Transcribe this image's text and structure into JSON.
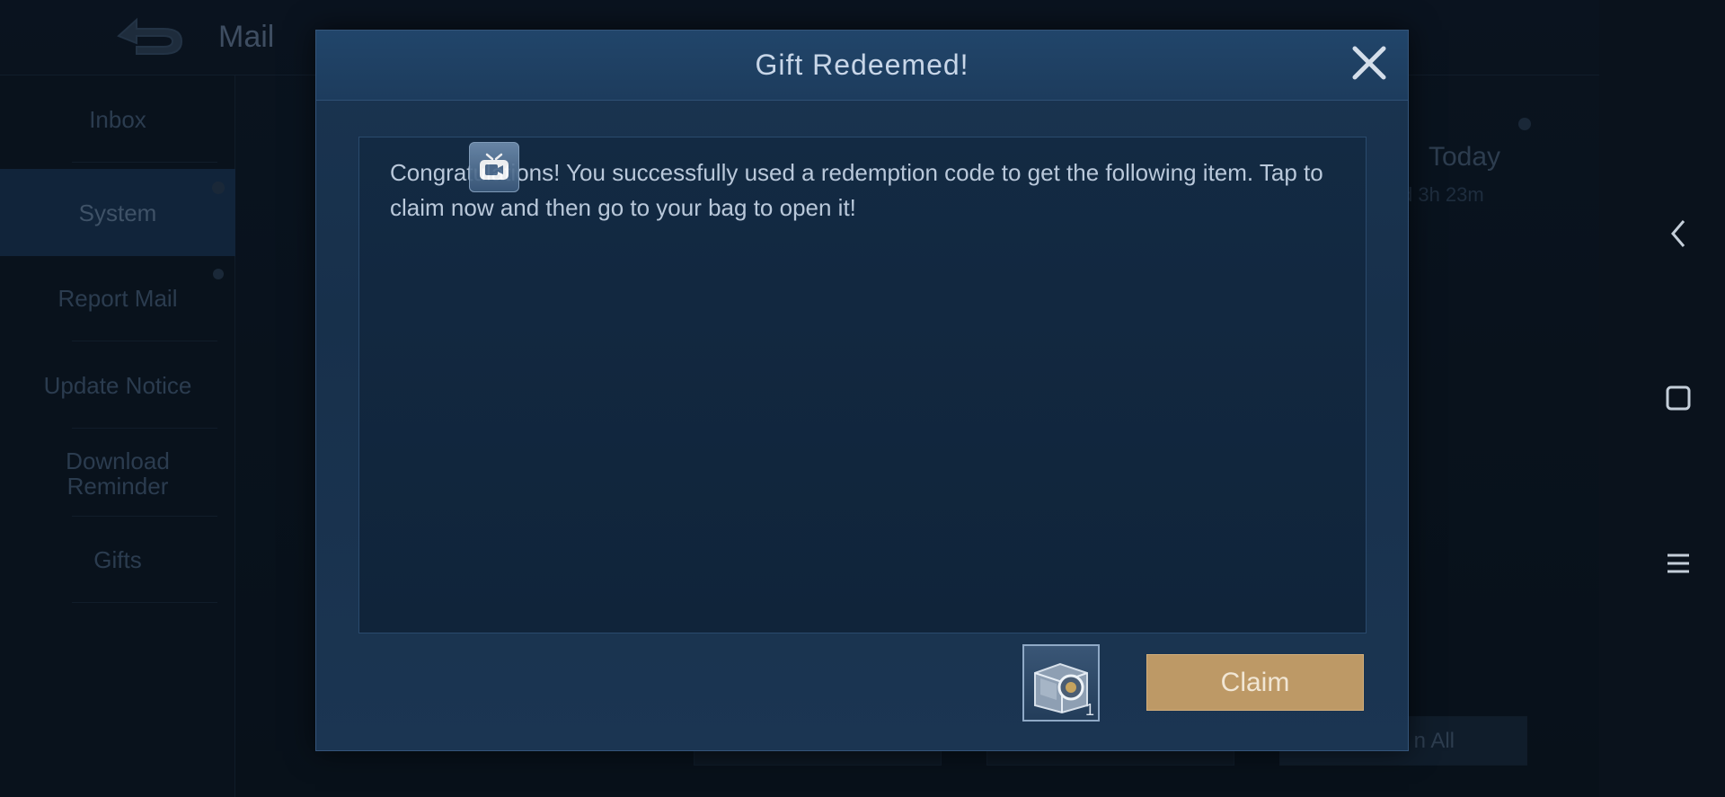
{
  "app": {
    "title": "Mail"
  },
  "sidebar": {
    "items": [
      {
        "label": "Inbox",
        "active": false
      },
      {
        "label": "System",
        "active": true
      },
      {
        "label": "Report Mail",
        "active": false
      },
      {
        "label": "Update Notice",
        "active": false
      },
      {
        "label": "Download Reminder",
        "active": false
      },
      {
        "label": "Gifts",
        "active": false
      }
    ]
  },
  "mail_list": {
    "date": "Today",
    "expiry_partial": "d 3h 23m"
  },
  "bottom_bar": {
    "claim_all_partial": "n All"
  },
  "dialog": {
    "title": "Gift Redeemed!",
    "message": "Congratulations! You successfully used a redemption code to get the following item. Tap to claim now and then go to your bag to open it!",
    "item": {
      "icon": "treasure-chest-icon",
      "count": "1"
    },
    "claim_label": "Claim",
    "close_icon": "close-icon"
  },
  "floating_overlay": {
    "icon": "screen-recorder-icon"
  },
  "system_nav": {
    "icons": [
      "back-chevron-icon",
      "home-square-icon",
      "menu-icon"
    ]
  },
  "colors": {
    "dialog_bg": "#1a3450",
    "claim_button": "#bd9966",
    "title_text": "#c8d6e8"
  }
}
